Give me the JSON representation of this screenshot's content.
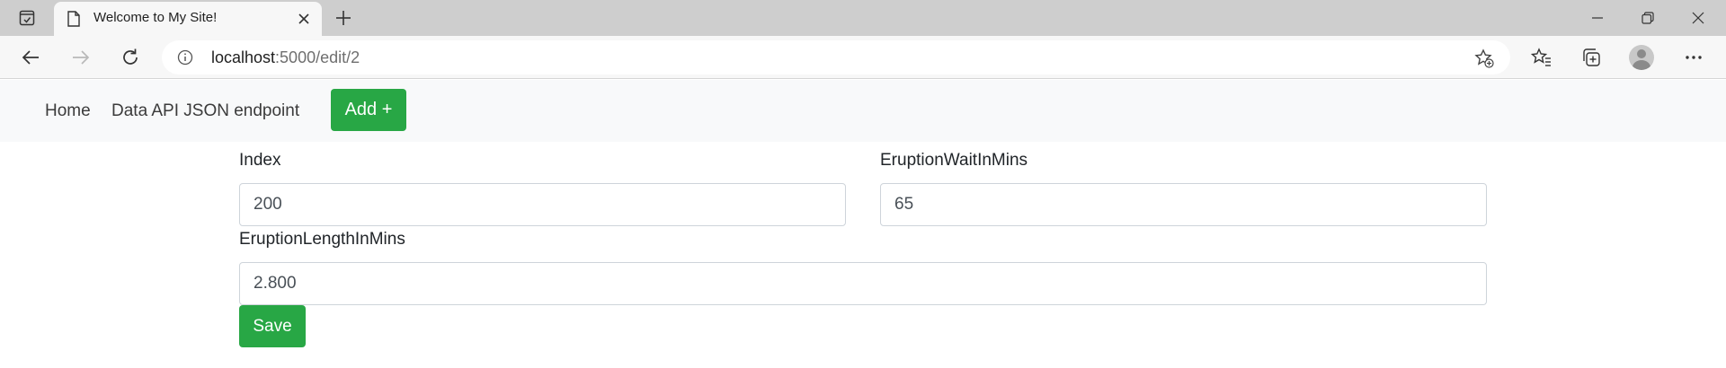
{
  "browser": {
    "tab": {
      "title": "Welcome to My Site!"
    },
    "address": {
      "host": "localhost",
      "path": ":5000/edit/2"
    }
  },
  "nav": {
    "home": "Home",
    "api": "Data API JSON endpoint",
    "add": "Add +"
  },
  "form": {
    "index": {
      "label": "Index",
      "value": "200"
    },
    "wait": {
      "label": "EruptionWaitInMins",
      "value": "65"
    },
    "length": {
      "label": "EruptionLengthInMins",
      "value": "2.800"
    },
    "save": "Save"
  },
  "colors": {
    "accent_green": "#28a745",
    "nav_background": "#f8f9fa",
    "tabstrip": "#cecece"
  }
}
